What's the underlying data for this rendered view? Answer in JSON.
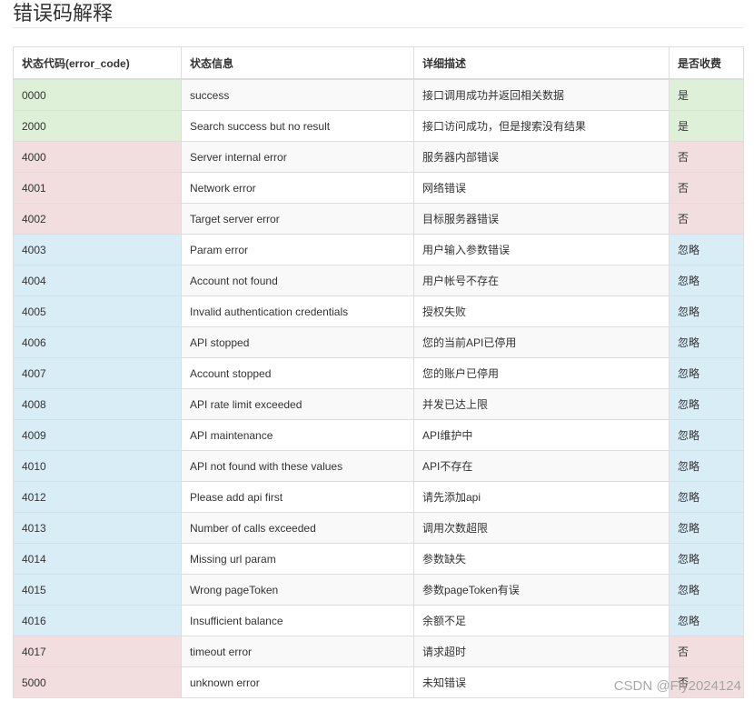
{
  "page": {
    "title": "错误码解释"
  },
  "table": {
    "headers": [
      "状态代码(error_code)",
      "状态信息",
      "详细描述",
      "是否收费"
    ],
    "rows": [
      {
        "code": "0000",
        "message": "success",
        "description": "接口调用成功并返回相关数据",
        "charged": "是",
        "status": "success"
      },
      {
        "code": "2000",
        "message": "Search success but no result",
        "description": "接口访问成功，但是搜索没有结果",
        "charged": "是",
        "status": "success"
      },
      {
        "code": "4000",
        "message": "Server internal error",
        "description": "服务器内部错误",
        "charged": "否",
        "status": "danger"
      },
      {
        "code": "4001",
        "message": "Network error",
        "description": "网络错误",
        "charged": "否",
        "status": "danger"
      },
      {
        "code": "4002",
        "message": "Target server error",
        "description": "目标服务器错误",
        "charged": "否",
        "status": "danger"
      },
      {
        "code": "4003",
        "message": "Param error",
        "description": "用户输入参数错误",
        "charged": "忽略",
        "status": "info"
      },
      {
        "code": "4004",
        "message": "Account not found",
        "description": "用户帐号不存在",
        "charged": "忽略",
        "status": "info"
      },
      {
        "code": "4005",
        "message": "Invalid authentication credentials",
        "description": "授权失败",
        "charged": "忽略",
        "status": "info"
      },
      {
        "code": "4006",
        "message": "API stopped",
        "description": "您的当前API已停用",
        "charged": "忽略",
        "status": "info"
      },
      {
        "code": "4007",
        "message": "Account stopped",
        "description": "您的账户已停用",
        "charged": "忽略",
        "status": "info"
      },
      {
        "code": "4008",
        "message": "API rate limit exceeded",
        "description": "并发已达上限",
        "charged": "忽略",
        "status": "info"
      },
      {
        "code": "4009",
        "message": "API maintenance",
        "description": "API维护中",
        "charged": "忽略",
        "status": "info"
      },
      {
        "code": "4010",
        "message": "API not found with these values",
        "description": "API不存在",
        "charged": "忽略",
        "status": "info"
      },
      {
        "code": "4012",
        "message": "Please add api first",
        "description": "请先添加api",
        "charged": "忽略",
        "status": "info"
      },
      {
        "code": "4013",
        "message": "Number of calls exceeded",
        "description": "调用次数超限",
        "charged": "忽略",
        "status": "info"
      },
      {
        "code": "4014",
        "message": "Missing url param",
        "description": "参数缺失",
        "charged": "忽略",
        "status": "info"
      },
      {
        "code": "4015",
        "message": "Wrong pageToken",
        "description": "参数pageToken有误",
        "charged": "忽略",
        "status": "info"
      },
      {
        "code": "4016",
        "message": "Insufficient balance",
        "description": "余额不足",
        "charged": "忽略",
        "status": "info"
      },
      {
        "code": "4017",
        "message": "timeout error",
        "description": "请求超时",
        "charged": "否",
        "status": "danger"
      },
      {
        "code": "5000",
        "message": "unknown error",
        "description": "未知错误",
        "charged": "否",
        "status": "danger"
      }
    ]
  },
  "colors": {
    "success": "#dff0d8",
    "danger": "#f2dede",
    "info": "#d9edf7",
    "stripe": "#f9f9f9",
    "border": "#dddddd"
  },
  "watermark": "CSDN @Fly2024124"
}
